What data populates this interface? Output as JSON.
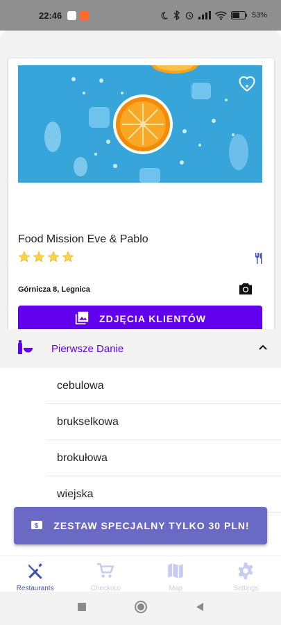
{
  "status_bar": {
    "time": "22:46",
    "battery": "53"
  },
  "restaurant": {
    "name": "Food Mission Eve & Pablo",
    "rating": 4,
    "address": "Górnicza 8, Legnica",
    "photos_button": "ZDJĘCIA KLIENTÓW"
  },
  "section": {
    "title": "Pierwsze Danie",
    "items": [
      "cebulowa",
      "brukselkowa",
      "brokułowa",
      "wiejska"
    ]
  },
  "promo": {
    "label": "ZESTAW SPECJALNY TYLKO 30 PLN!"
  },
  "bottom_nav": {
    "items": [
      {
        "label": "Restaurants",
        "icon": "cutlery-icon"
      },
      {
        "label": "Checkout",
        "icon": "cart-icon"
      },
      {
        "label": "Map",
        "icon": "map-icon"
      },
      {
        "label": "Settings",
        "icon": "gear-icon"
      }
    ]
  },
  "colors": {
    "primary": "#6200ee",
    "promo": "#6a6ac4",
    "nav_active": "#3f51b5"
  }
}
